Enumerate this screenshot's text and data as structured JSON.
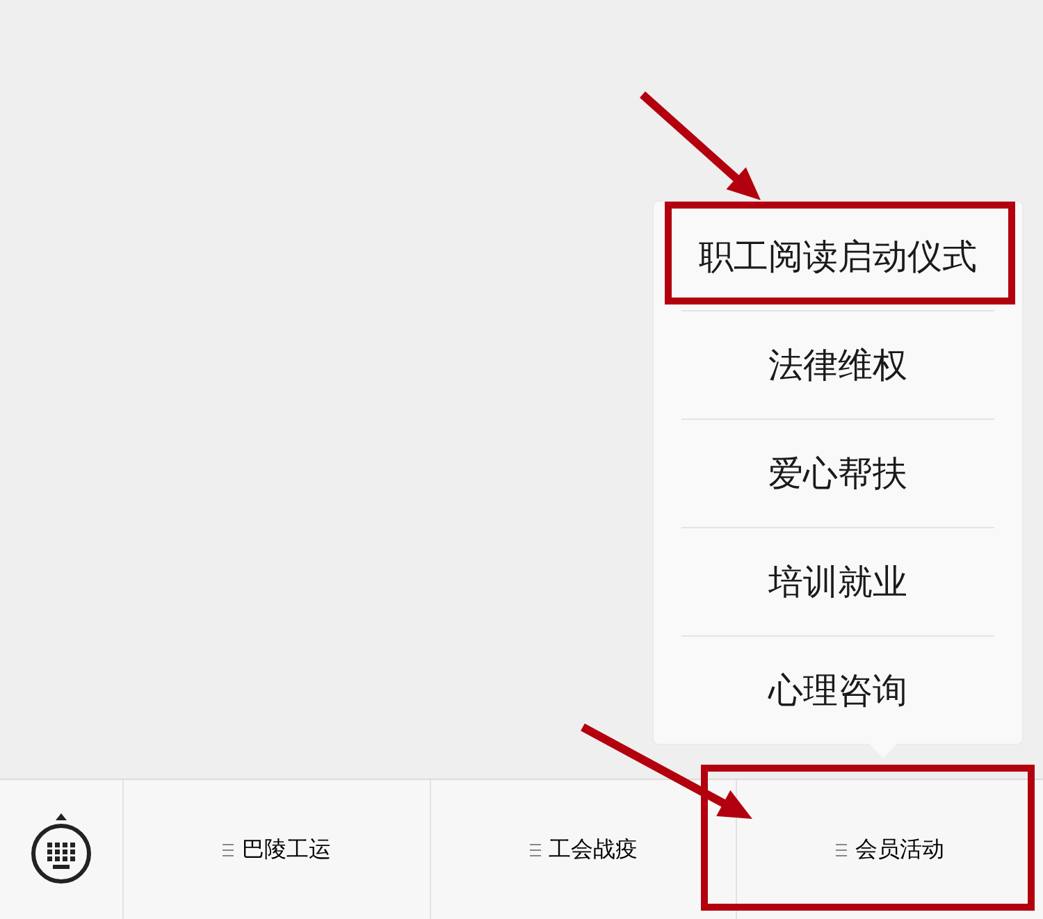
{
  "menu": {
    "items": [
      {
        "label": "职工阅读启动仪式",
        "highlighted": true
      },
      {
        "label": "法律维权",
        "highlighted": false
      },
      {
        "label": "爱心帮扶",
        "highlighted": false
      },
      {
        "label": "培训就业",
        "highlighted": false
      },
      {
        "label": "心理咨询",
        "highlighted": false
      }
    ]
  },
  "tab_bar": {
    "tabs": [
      {
        "label": "巴陵工运",
        "highlighted": false
      },
      {
        "label": "工会战疫",
        "highlighted": false
      },
      {
        "label": "会员活动",
        "highlighted": true
      }
    ]
  }
}
